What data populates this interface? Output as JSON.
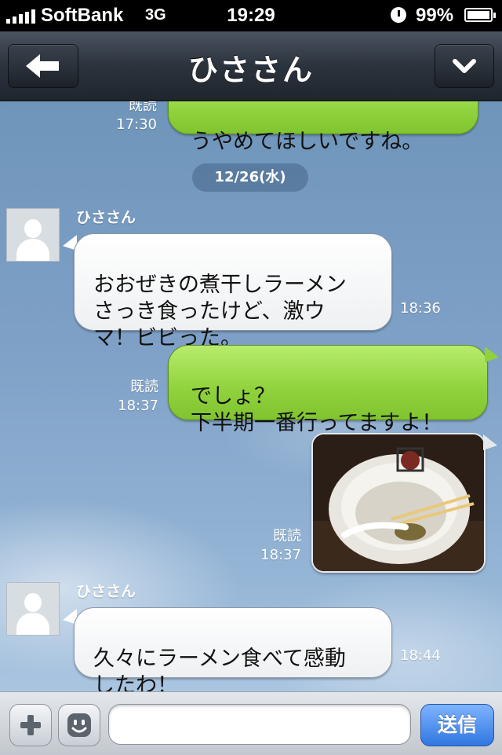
{
  "status_bar": {
    "carrier": "SoftBank",
    "network": "3G",
    "time": "19:29",
    "battery": "99%"
  },
  "nav": {
    "title": "ひささん",
    "back_icon": "back-arrow-icon",
    "menu_icon": "chevron-down-icon"
  },
  "chat": {
    "date_separator": "12/26(水)",
    "messages": [
      {
        "direction": "out",
        "text": "うやめてほしいですね。",
        "read": "既読",
        "time": "17:30"
      },
      {
        "direction": "in",
        "sender": "ひささん",
        "text": "おおぜきの煮干しラーメン\nさっき食ったけど、激ウ\nマ！ビビった。",
        "time": "18:36"
      },
      {
        "direction": "out",
        "text": "でしょ？\n下半期一番行ってますよ！",
        "read": "既読",
        "time": "18:37"
      },
      {
        "direction": "out",
        "type": "image",
        "image_icon": "ramen-bowl-photo",
        "read": "既読",
        "time": "18:37"
      },
      {
        "direction": "in",
        "sender": "ひささん",
        "text": "久々にラーメン食べて感動\nしたわ！",
        "time": "18:44"
      }
    ]
  },
  "input_bar": {
    "plus_icon": "plus-icon",
    "emoji_icon": "emoji-icon",
    "input_value": "",
    "send_label": "送信"
  },
  "colors": {
    "outgoing_bubble": "#8fd23c",
    "incoming_bubble": "#ffffff",
    "send_button": "#2f77e0",
    "nav_bar": "#2b333d"
  }
}
